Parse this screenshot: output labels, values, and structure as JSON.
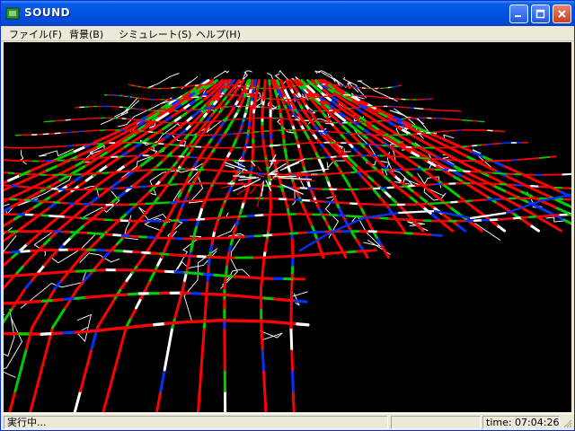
{
  "window": {
    "title": "SOUND",
    "app_icon": "app-icon"
  },
  "titlebar_buttons": {
    "minimize": "minimize-icon",
    "maximize": "maximize-icon",
    "close": "close-icon"
  },
  "menu": {
    "items": [
      {
        "label": "ファイル(F)"
      },
      {
        "label": "背景(B)"
      },
      {
        "label": "シミュレート(S)"
      },
      {
        "label": "ヘルプ(H)"
      }
    ]
  },
  "viewport": {
    "background": "#000000",
    "link_colors": [
      "#ff0000",
      "#00cc00",
      "#0033ff",
      "#ffffff"
    ]
  },
  "status": {
    "message": "実行中...",
    "middle": "",
    "time": "time: 07:04:26"
  }
}
